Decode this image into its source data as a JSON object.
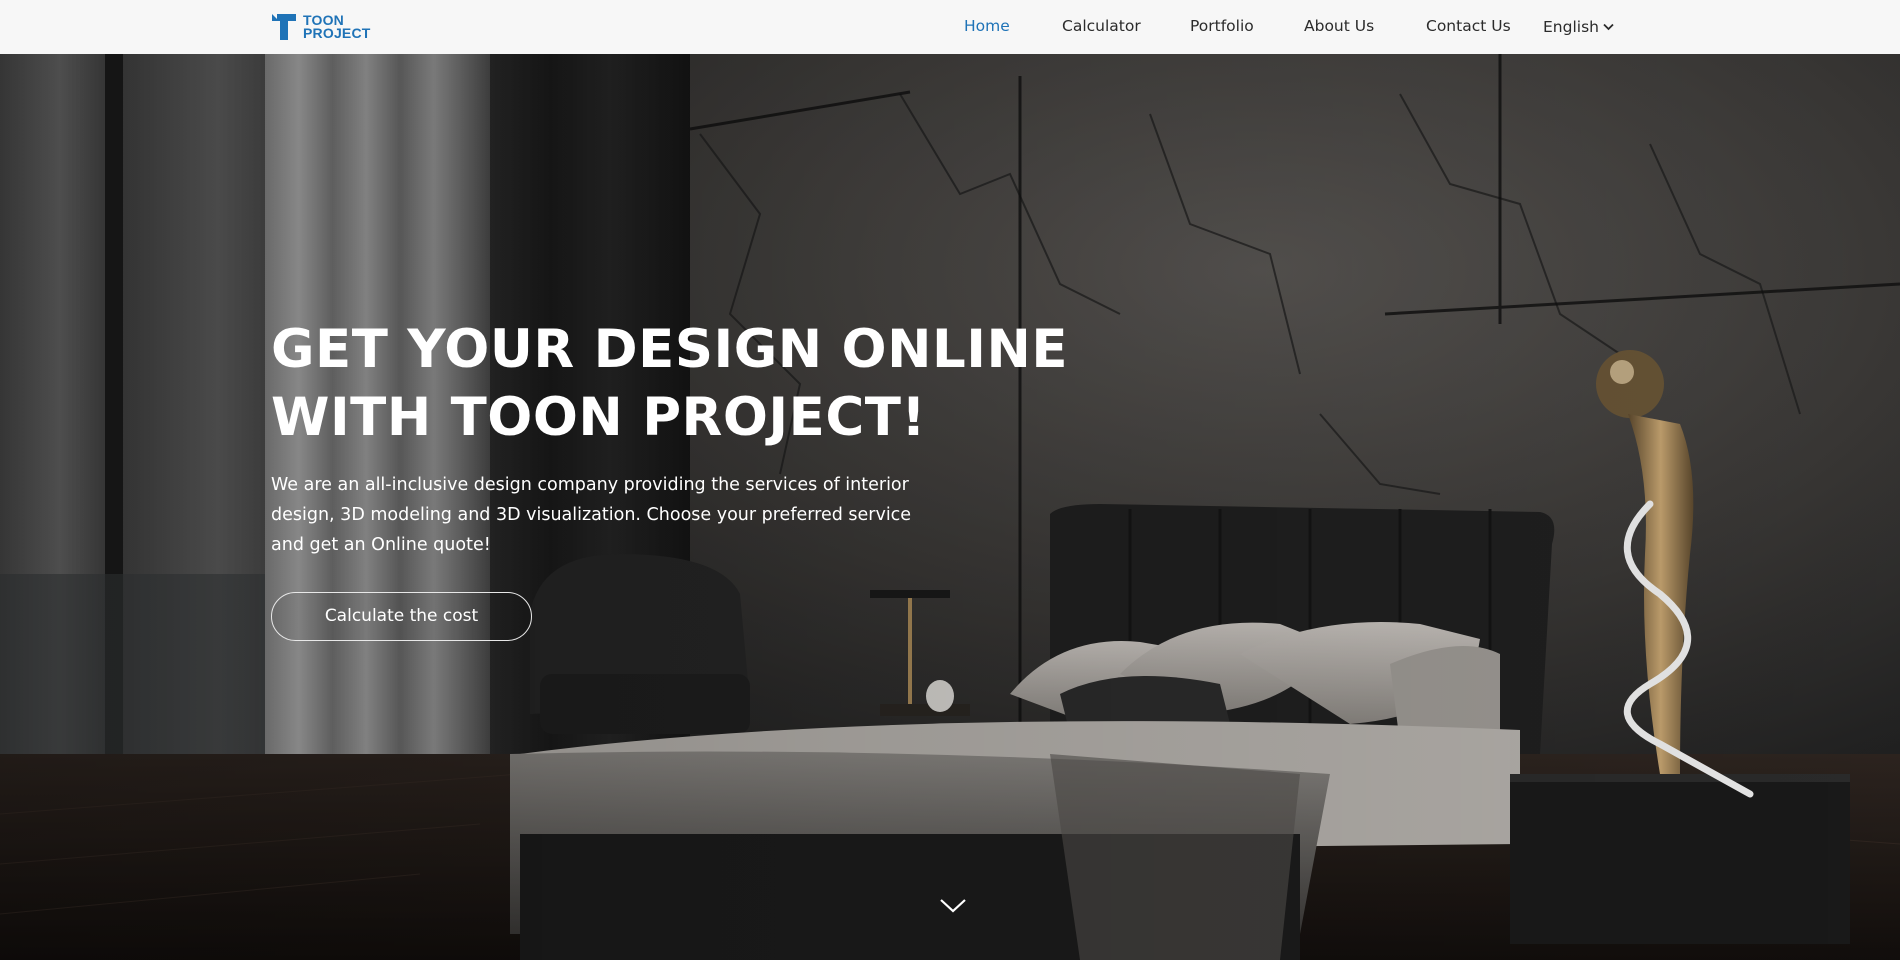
{
  "brand": {
    "line1": "TOON",
    "line2": "PROJECT",
    "color": "#1f73b7"
  },
  "nav": {
    "items": [
      {
        "label": "Home",
        "active": true
      },
      {
        "label": "Calculator"
      },
      {
        "label": "Portfolio"
      },
      {
        "label": "About Us"
      },
      {
        "label": "Contact Us"
      }
    ],
    "language": "English"
  },
  "hero": {
    "headline_line1": "GET YOUR DESIGN ONLINE",
    "headline_line2": "WITH TOON PROJECT!",
    "description_line1": "We are an all-inclusive design company providing the services of interior",
    "description_line2": "design, 3D modeling and 3D visualization. Choose your preferred service",
    "description_line3": "and get an Online quote!",
    "cta_label": "Calculate the cost",
    "scroll_icon": "chevron-down-icon"
  }
}
